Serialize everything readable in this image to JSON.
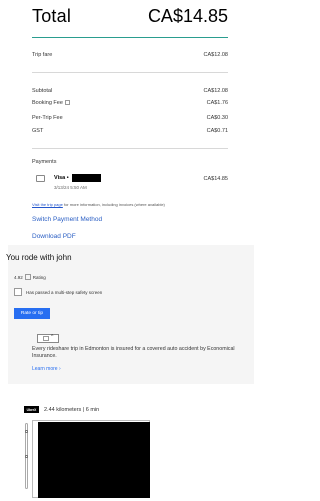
{
  "total": {
    "label": "Total",
    "amount": "CA$14.85"
  },
  "fare": {
    "label": "Trip fare",
    "amount": "CA$12.08"
  },
  "breakdown": [
    {
      "label": "Subtotal",
      "amount": "CA$12.08"
    },
    {
      "label": "Booking Fee",
      "amount": "CA$1.76"
    },
    {
      "label": "Per-Trip Fee",
      "amount": "CA$0.30"
    },
    {
      "label": "GST",
      "amount": "CA$0.71"
    }
  ],
  "payments": {
    "title": "Payments",
    "method": "Visa •",
    "datetime": "3/13/24 5:50 AM",
    "amount": "CA$14.85",
    "trip_page_link": "Visit the trip page",
    "trip_page_note": " for more information, including invoices (where available)"
  },
  "links": {
    "switch_payment": "Switch Payment Method",
    "download_pdf": "Download PDF"
  },
  "rode": {
    "title": "You rode with john",
    "rating_value": "4.92",
    "rating_label": "Rating",
    "safety_text": "Has passed a multi-step safety screen",
    "rate_button": "Rate or tip",
    "insurance_caret": "^",
    "insurance_text": "Every rideshare trip in Edmonton is insured for a covered auto accident by Economical Insurance.",
    "learn_more": "Learn more ›"
  },
  "trip": {
    "product": "UberX",
    "summary": "2.44 kilometers | 6 min"
  },
  "colors": {
    "accent_teal": "#2a9d8f",
    "link_blue": "#2b5fc4",
    "button_blue": "#276ef1"
  }
}
